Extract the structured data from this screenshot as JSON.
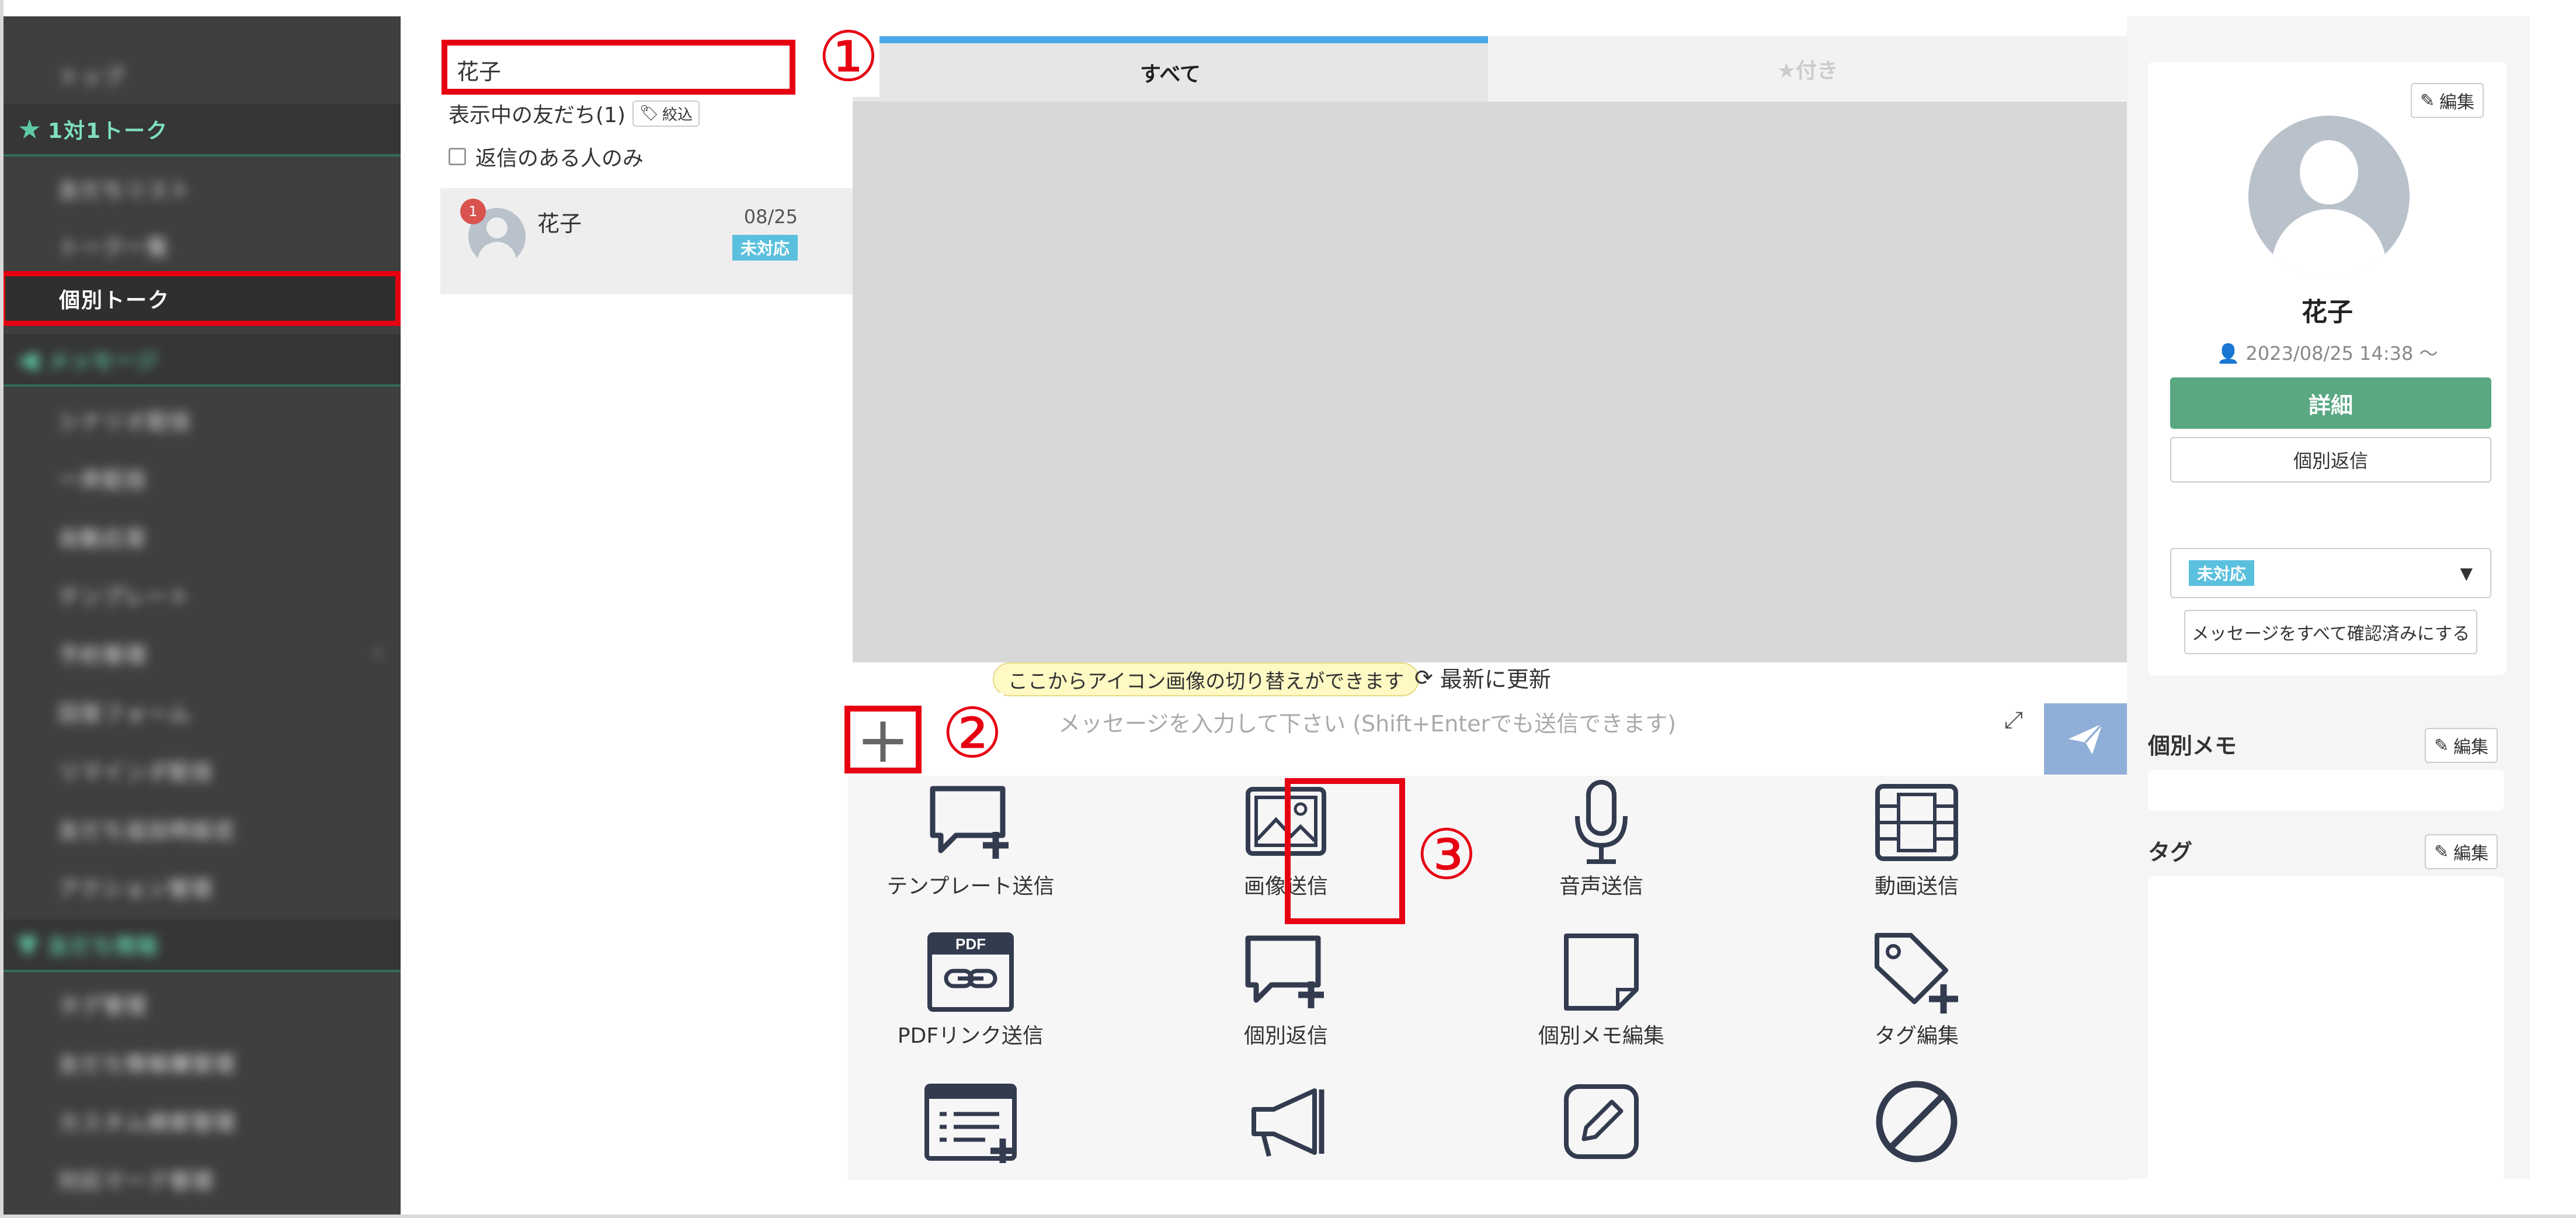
{
  "sidebar": {
    "items": [
      {
        "label": "トップ",
        "type": "item",
        "blur": true
      },
      {
        "label": "1対1トーク",
        "type": "section",
        "icon": "star-icon"
      },
      {
        "label": "友だちリスト",
        "type": "item",
        "blur": true
      },
      {
        "label": "トーク一覧",
        "type": "item",
        "blur": true
      },
      {
        "label": "個別トーク",
        "type": "selected"
      },
      {
        "label": "メッセージ",
        "type": "section",
        "icon": "megaphone-icon",
        "blur": true
      },
      {
        "label": "シナリオ配信",
        "type": "item",
        "blur": true
      },
      {
        "label": "一斉配信",
        "type": "item",
        "blur": true
      },
      {
        "label": "自動応答",
        "type": "item",
        "blur": true
      },
      {
        "label": "テンプレート",
        "type": "item",
        "blur": true
      },
      {
        "label": "予約管理",
        "type": "item",
        "blur": true,
        "has_arrow": true
      },
      {
        "label": "回答フォーム",
        "type": "item",
        "blur": true
      },
      {
        "label": "リマインダ配信",
        "type": "item",
        "blur": true
      },
      {
        "label": "友だち追加時設定",
        "type": "item",
        "blur": true
      },
      {
        "label": "アクション管理",
        "type": "item",
        "blur": true
      },
      {
        "label": "友だち情報",
        "type": "section",
        "icon": "filter-icon",
        "blur": true
      },
      {
        "label": "タグ管理",
        "type": "item",
        "blur": true
      },
      {
        "label": "友だち情報欄管理",
        "type": "item",
        "blur": true
      },
      {
        "label": "カスタム検索管理",
        "type": "item",
        "blur": true
      },
      {
        "label": "対応マーク管理",
        "type": "item",
        "blur": true
      }
    ]
  },
  "friend_list": {
    "search_value": "花子",
    "friends_count_label": "表示中の友だち(1)",
    "filter_label": "絞込",
    "reply_only_label": "返信のある人のみ",
    "items": [
      {
        "name": "花子",
        "date": "08/25",
        "status": "未対応",
        "unread": "1"
      }
    ]
  },
  "annotations": {
    "step1": "①",
    "step2": "②",
    "step3": "③"
  },
  "chat": {
    "tab_all": "すべて",
    "tab_starred": "★付き",
    "tip": "ここからアイコン画像の切り替えができます",
    "refresh": "最新に更新",
    "input_placeholder": "メッセージを入力して下さい (Shift+Enterでも送信できます)",
    "plus": "+"
  },
  "actions": [
    {
      "label": "テンプレート送信",
      "icon": "template-send-icon"
    },
    {
      "label": "画像送信",
      "icon": "image-icon"
    },
    {
      "label": "音声送信",
      "icon": "microphone-icon"
    },
    {
      "label": "動画送信",
      "icon": "film-icon"
    },
    {
      "label": "PDFリンク送信",
      "icon": "pdf-link-icon"
    },
    {
      "label": "個別返信",
      "icon": "reply-bubble-icon"
    },
    {
      "label": "個別メモ編集",
      "icon": "memo-icon"
    },
    {
      "label": "タグ編集",
      "icon": "tag-icon"
    },
    {
      "label": "",
      "icon": "list-add-icon"
    },
    {
      "label": "",
      "icon": "megaphone-icon"
    },
    {
      "label": "",
      "icon": "pencil-icon"
    },
    {
      "label": "",
      "icon": "block-icon"
    }
  ],
  "profile": {
    "edit_label": "編集",
    "name": "花子",
    "registered": "2023/08/25 14:38 〜",
    "detail_label": "詳細",
    "reply_label": "個別返信",
    "status": "未対応",
    "confirm_label": "メッセージをすべて確認済みにする",
    "memo_title": "個別メモ",
    "tag_title": "タグ"
  },
  "colors": {
    "annotation": "#e60012",
    "accent_green": "#5aa882",
    "badge_blue": "#5bc0de",
    "tab_accent": "#4aa8e8",
    "sidebar_bg": "#3f3f3f"
  }
}
